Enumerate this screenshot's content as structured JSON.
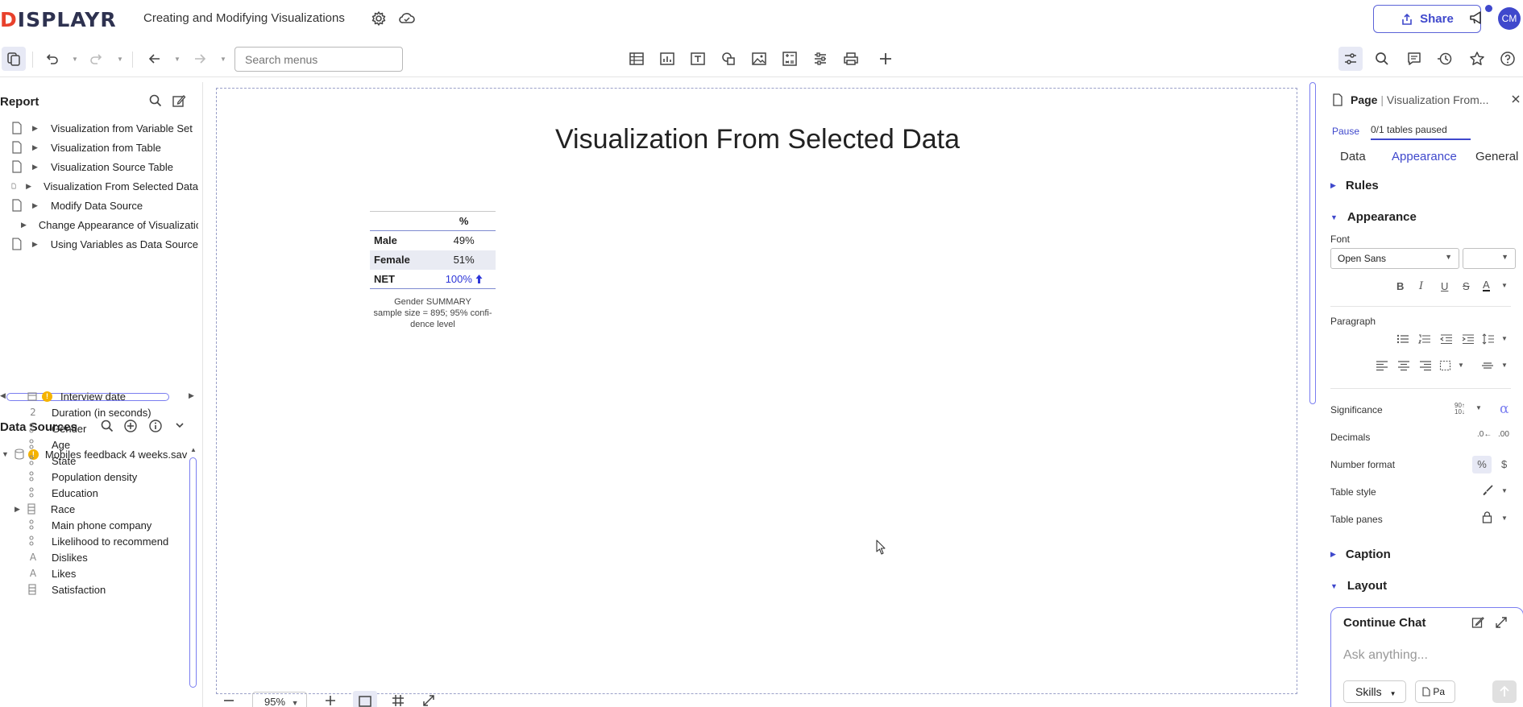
{
  "app": {
    "logo_letters": "ISPLAYR",
    "logo_first": "D",
    "doc_title": "Creating and Modifying Visualizations",
    "share_label": "Share",
    "avatar_initials": "CM"
  },
  "toolbar": {
    "search_placeholder": "Search menus"
  },
  "report": {
    "title": "Report",
    "items": [
      "Visualization from Variable Set",
      "Visualization from Table",
      "Visualization Source Table",
      "Visualization From Selected Data",
      "Modify Data Source",
      "Change Appearance of Visualization",
      "Using Variables as Data Source"
    ]
  },
  "data_sources": {
    "title": "Data Sources",
    "file": "Mobiles feedback 4 weeks.sav",
    "items": [
      {
        "icon": "date-icon",
        "label": "Interview date",
        "warn": true
      },
      {
        "icon": "2",
        "label": "Duration (in seconds)"
      },
      {
        "icon": "categorical-icon",
        "label": "Gender"
      },
      {
        "icon": "categorical-icon",
        "label": "Age"
      },
      {
        "icon": "categorical-icon",
        "label": "State"
      },
      {
        "icon": "categorical-icon",
        "label": "Population density"
      },
      {
        "icon": "categorical-icon",
        "label": "Education"
      },
      {
        "icon": "grid-icon",
        "label": "Race",
        "expandable": true
      },
      {
        "icon": "categorical-icon",
        "label": "Main phone company"
      },
      {
        "icon": "categorical-icon",
        "label": "Likelihood to recommend"
      },
      {
        "icon": "A",
        "label": "Dislikes"
      },
      {
        "icon": "A",
        "label": "Likes"
      },
      {
        "icon": "grid-icon",
        "label": "Satisfaction"
      }
    ]
  },
  "canvas": {
    "page_title": "Visualization From Selected Data",
    "table": {
      "header": "%",
      "rows": [
        {
          "label": "Male",
          "value": "49%"
        },
        {
          "label": "Female",
          "value": "51%"
        },
        {
          "label": "NET",
          "value": "100%"
        }
      ]
    },
    "caption_line1": "Gender SUMMARY",
    "caption_line2": "sample size = 895; 95% confi-",
    "caption_line3": "dence level",
    "zoom": "95%"
  },
  "right_panel": {
    "title": "Page",
    "subtitle": "Visualization From...",
    "pause": "Pause",
    "paused_status": "0/1 tables paused",
    "tabs": [
      "Data",
      "Appearance",
      "General"
    ],
    "active_tab": "Appearance",
    "sections": {
      "rules": "Rules",
      "appearance": "Appearance",
      "caption": "Caption",
      "layout": "Layout"
    },
    "font_label": "Font",
    "font_value": "Open Sans",
    "paragraph_label": "Paragraph",
    "significance": "Significance",
    "decimals": "Decimals",
    "number_format": "Number format",
    "table_style": "Table style",
    "table_panes": "Table panes",
    "chat_title": "Continue Chat",
    "chat_placeholder": "Ask anything...",
    "skills_label": "Skills",
    "page_chip": "Pa"
  },
  "colors": {
    "accent": "#3f48cc",
    "warning": "#f5b301",
    "logo_red": "#e8412c"
  }
}
